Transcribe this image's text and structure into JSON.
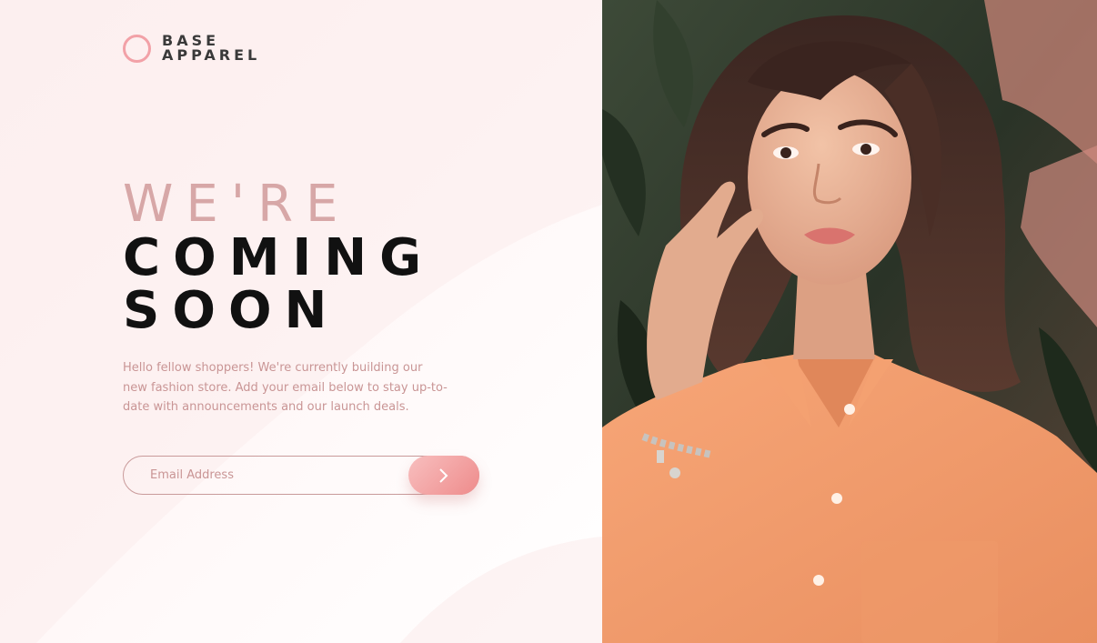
{
  "brand": {
    "line1": "BASE",
    "line2": "APPAREL"
  },
  "hero": {
    "headline_light": "WE'RE",
    "headline_bold_1": "COMING",
    "headline_bold_2": "SOON",
    "intro": "Hello fellow shoppers! We're currently building our new fashion store. Add your email below to stay up-to-date with announcements and our launch deals."
  },
  "signup": {
    "placeholder": "Email Address",
    "value": "",
    "submit_icon": "chevron-right-icon"
  },
  "photo": {
    "alt": "Woman wearing an orange shirt"
  },
  "colors": {
    "accent": "#f2a1a7",
    "headline_light": "#d7a7a7",
    "text": "#c99595",
    "headline_dark": "#111111",
    "button_start": "#f8bfbf",
    "button_end": "#ee8b8b"
  }
}
